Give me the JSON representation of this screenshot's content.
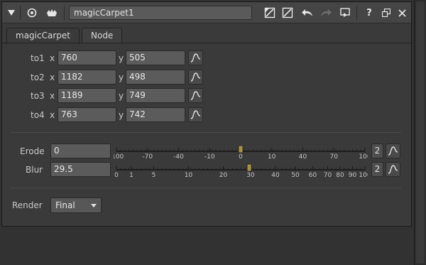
{
  "node_name": "magicCarpet1",
  "toolbar": {
    "help_label": "?"
  },
  "tabs": [
    {
      "label": "magicCarpet"
    },
    {
      "label": "Node"
    }
  ],
  "corners": [
    {
      "label": "to1",
      "x_label": "x",
      "x": "760",
      "y_label": "y",
      "y": "505"
    },
    {
      "label": "to2",
      "x_label": "x",
      "x": "1182",
      "y_label": "y",
      "y": "498"
    },
    {
      "label": "to3",
      "x_label": "x",
      "x": "1189",
      "y_label": "y",
      "y": "749"
    },
    {
      "label": "to4",
      "x_label": "x",
      "x": "763",
      "y_label": "y",
      "y": "742"
    }
  ],
  "erode": {
    "label": "Erode",
    "value": "0",
    "ticks": [
      "-100",
      "-70",
      "-40",
      "-10",
      "0",
      "10",
      "40",
      "70",
      "100"
    ],
    "slider_min": -100,
    "slider_max": 100,
    "slider_value": 0,
    "dim_button": "2"
  },
  "blur": {
    "label": "Blur",
    "value": "29.5",
    "ticks": [
      "0",
      "1",
      "5",
      "10",
      "20",
      "30",
      "40",
      "50",
      "60",
      "70",
      "80",
      "90",
      "100"
    ],
    "slider_max": 100,
    "slider_value": 29.5,
    "dim_button": "2"
  },
  "render": {
    "label": "Render",
    "value": "Final"
  },
  "colors": {
    "slider_handle": "#a89440",
    "panel_bg": "#3a3a3a"
  }
}
